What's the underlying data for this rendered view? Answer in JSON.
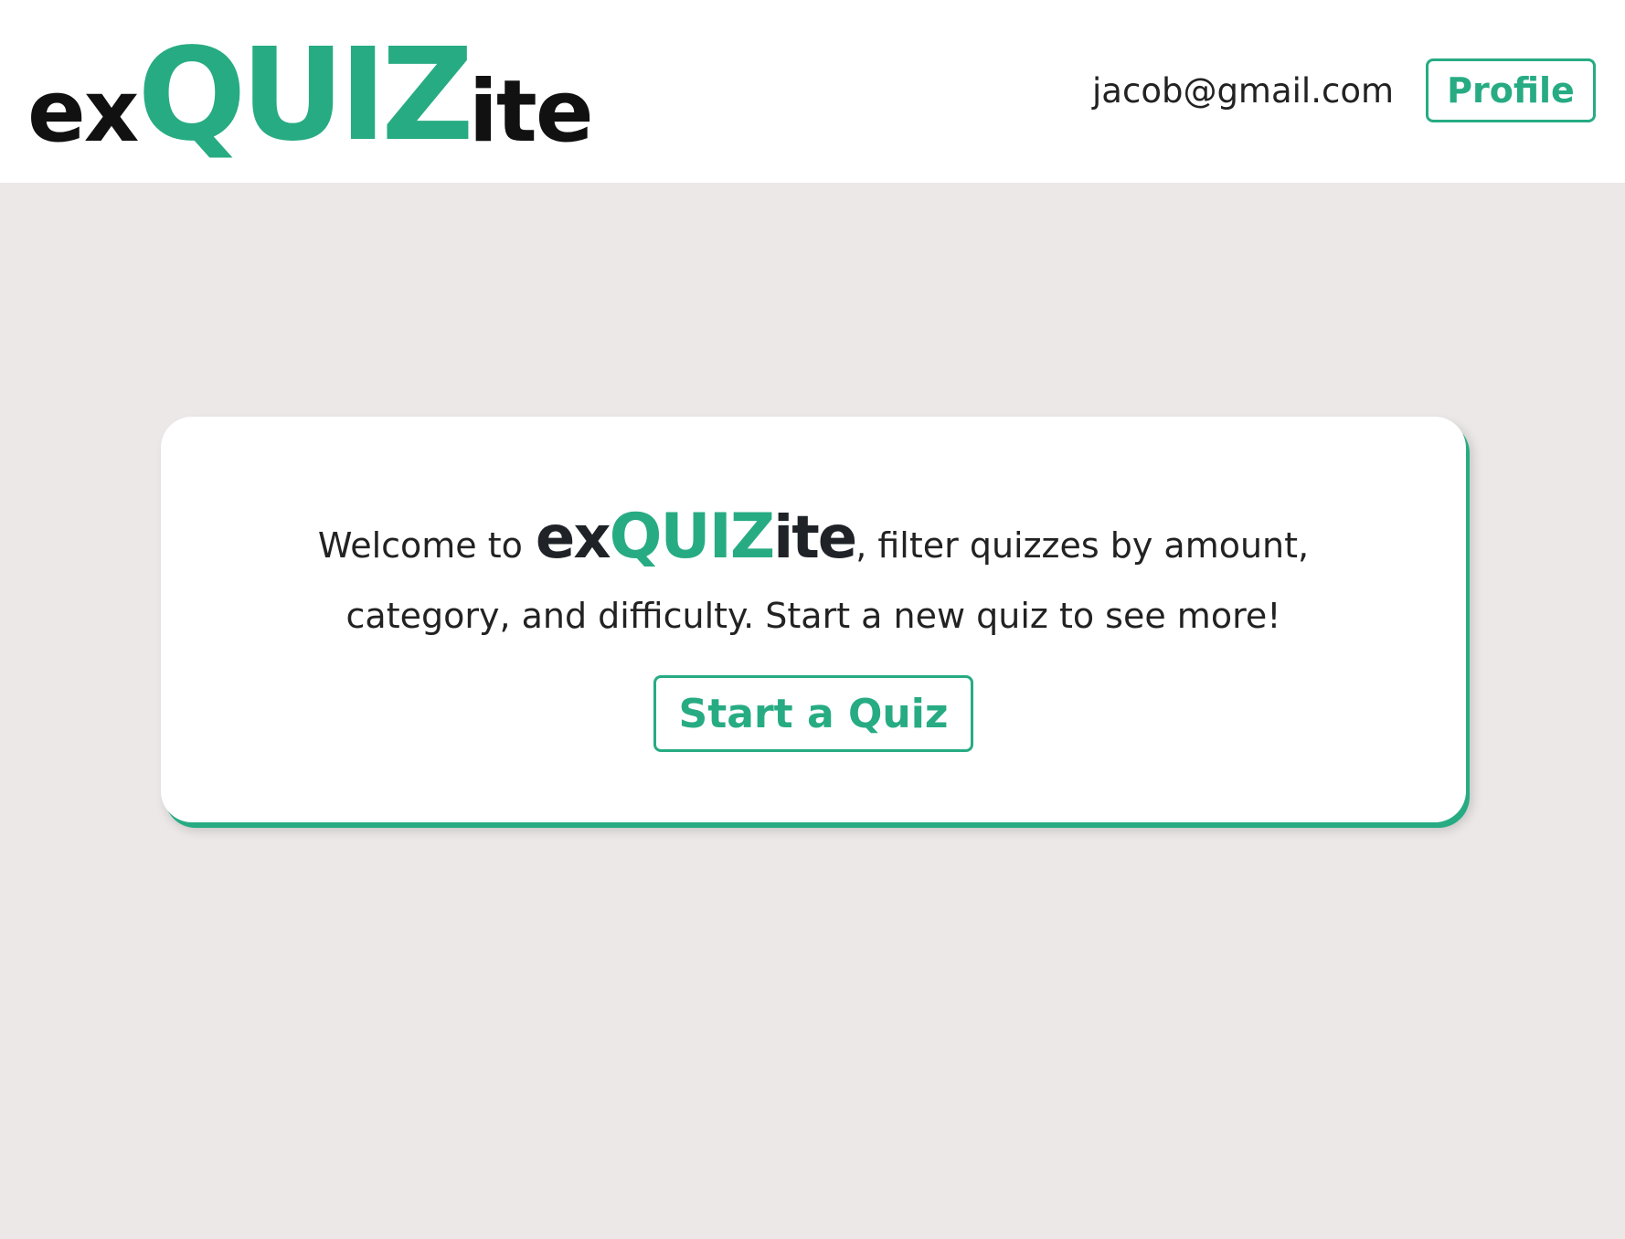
{
  "header": {
    "logo": {
      "prefix": "ex",
      "highlight": "QUIZ",
      "suffix": "ite"
    },
    "user_email": "jacob@gmail.com",
    "profile_label": "Profile"
  },
  "main": {
    "welcome_prefix": "Welcome to",
    "welcome_logo": {
      "prefix": "ex",
      "highlight": "QUIZ",
      "suffix": "ite"
    },
    "welcome_after_logo": ", filter quizzes by amount,",
    "welcome_line2": "category, and difficulty. Start a new quiz to see more!",
    "start_button_label": "Start a Quiz"
  },
  "colors": {
    "accent": "#27ab83",
    "background": "#ebe8e7",
    "card": "#ffffff"
  }
}
